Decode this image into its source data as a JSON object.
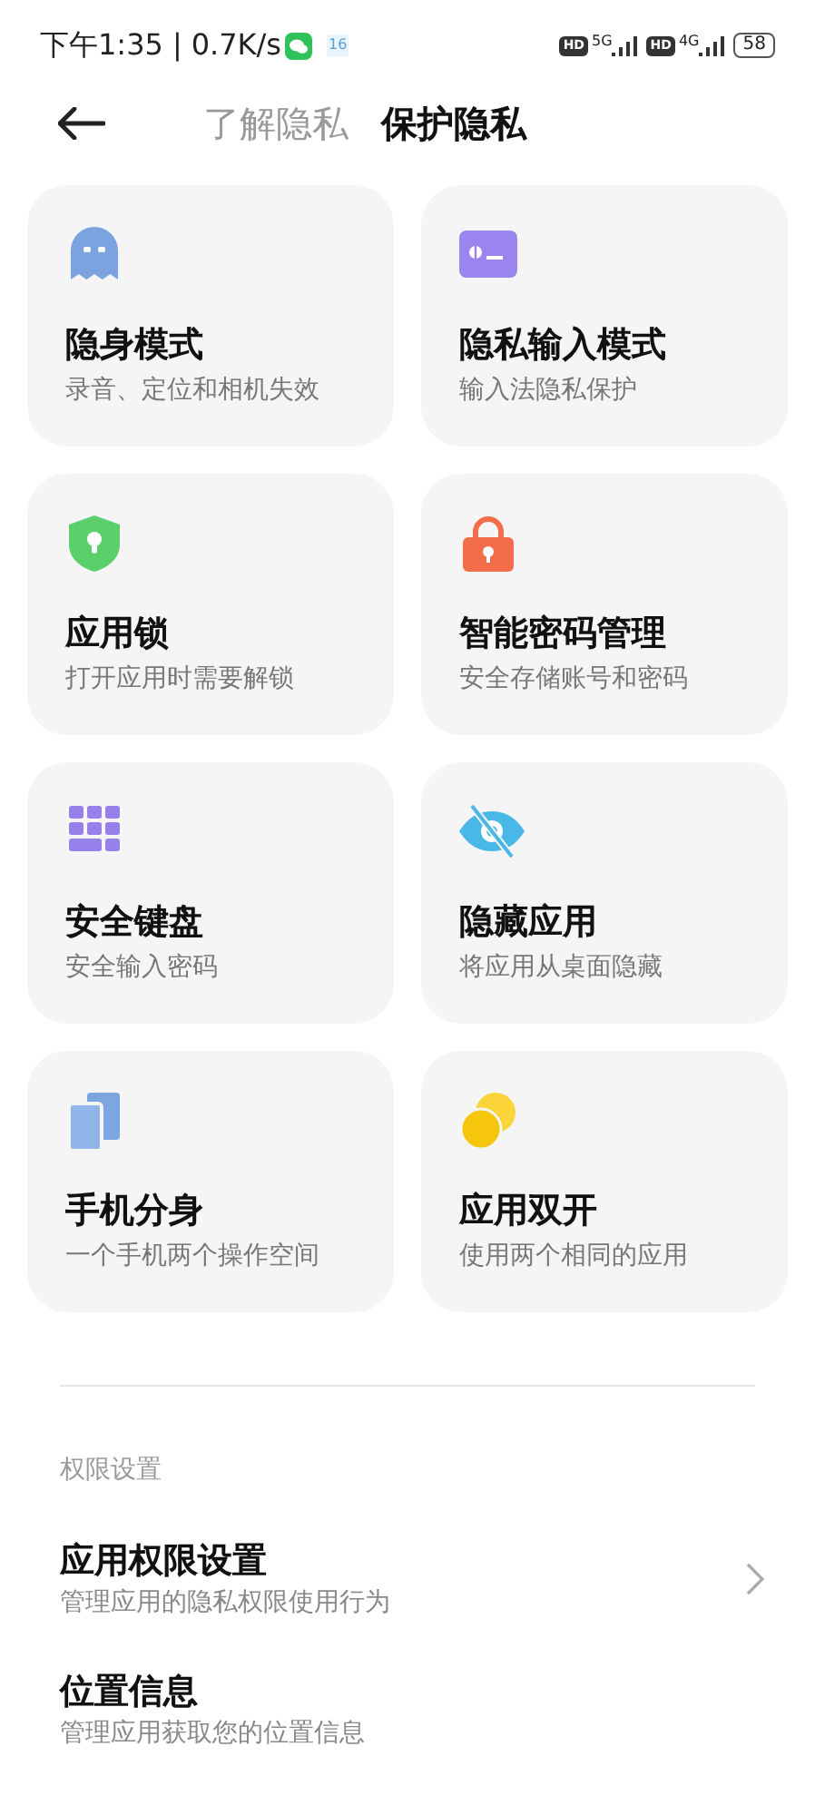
{
  "status_bar": {
    "time": "下午1:35",
    "separator": "|",
    "speed": "0.7K/s",
    "calendar_badge": "16",
    "sim1": {
      "hd": "HD",
      "network": "5G"
    },
    "sim2": {
      "hd": "HD",
      "network": "4G"
    },
    "battery": "58"
  },
  "tabs": [
    {
      "label": "了解隐私",
      "selected": false
    },
    {
      "label": "保护隐私",
      "selected": true
    }
  ],
  "cards": [
    {
      "title": "隐身模式",
      "subtitle": "录音、定位和相机失效"
    },
    {
      "title": "隐私输入模式",
      "subtitle": "输入法隐私保护"
    },
    {
      "title": "应用锁",
      "subtitle": "打开应用时需要解锁"
    },
    {
      "title": "智能密码管理",
      "subtitle": "安全存储账号和密码"
    },
    {
      "title": "安全键盘",
      "subtitle": "安全输入密码"
    },
    {
      "title": "隐藏应用",
      "subtitle": "将应用从桌面隐藏"
    },
    {
      "title": "手机分身",
      "subtitle": "一个手机两个操作空间"
    },
    {
      "title": "应用双开",
      "subtitle": "使用两个相同的应用"
    }
  ],
  "section_title": "权限设置",
  "list": [
    {
      "title": "应用权限设置",
      "subtitle": "管理应用的隐私权限使用行为",
      "chevron": true
    },
    {
      "title": "位置信息",
      "subtitle": "管理应用获取您的位置信息",
      "chevron": false
    }
  ]
}
